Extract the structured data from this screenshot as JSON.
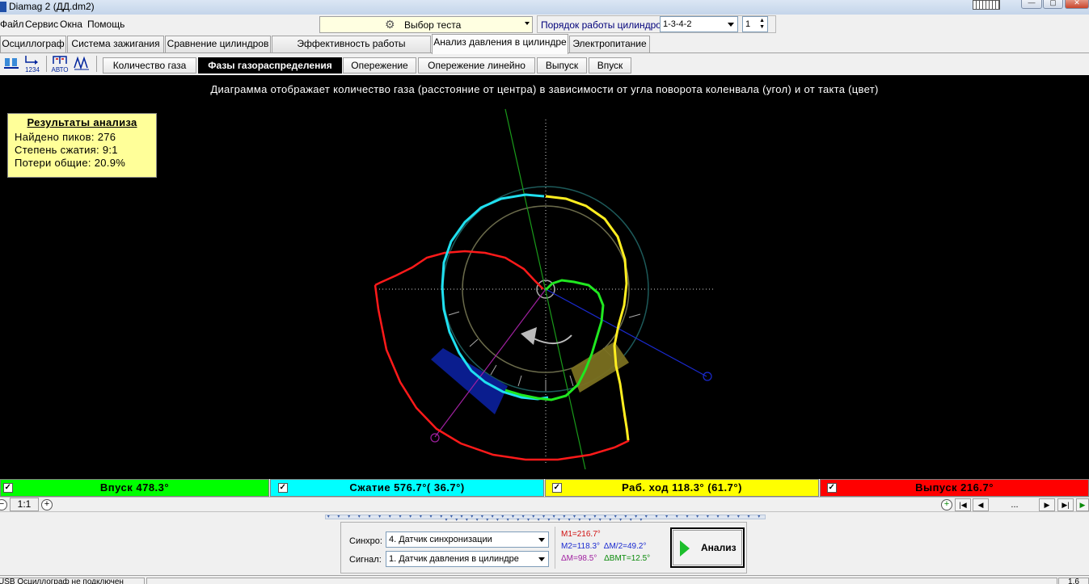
{
  "window": {
    "title": "Diamag 2 (ДД.dm2)",
    "controls": [
      "—",
      "▢",
      "✕"
    ]
  },
  "menu": {
    "items": [
      "Файл",
      "Сервис",
      "Окна",
      "Помощь"
    ]
  },
  "test_selector": {
    "label": "Выбор теста"
  },
  "cylinder_order": {
    "label": "Порядок работы цилиндров",
    "value": "1-3-4-2",
    "cylinder": "1"
  },
  "main_tabs": [
    "Осциллограф",
    "Система зажигания",
    "Сравнение цилиндров",
    "Эффективность работы цилиндров",
    "Анализ давления в цилиндре",
    "Электропитание"
  ],
  "toolbar": {
    "auto_label": "АВТО",
    "seq_label": "1234"
  },
  "sub_tabs": [
    "Количество газа",
    "Фазы газораспределения",
    "Опережение",
    "Опережение линейно",
    "Выпуск",
    "Впуск"
  ],
  "diagram": {
    "caption": "Диаграмма отображает количество газа (расстояние от центра) в зависимости от угла поворота коленвала (угол) и от такта (цвет)"
  },
  "results": {
    "title": "Результаты анализа",
    "lines": [
      "Найдено пиков: 276",
      "Степень сжатия: 9:1",
      "Потери общие: 20.9%"
    ]
  },
  "phases": [
    {
      "label": "Впуск 478.3°",
      "color": "#00ff00"
    },
    {
      "label": "Сжатие 576.7°( 36.7°)",
      "color": "#00ffff"
    },
    {
      "label": "Раб. ход 118.3° (61.7°)",
      "color": "#ffff00"
    },
    {
      "label": "Выпуск 216.7°",
      "color": "#ff0000"
    }
  ],
  "zoom": {
    "ratio": "1:1",
    "page": "..."
  },
  "controls": {
    "sync_label": "Синхро:",
    "sync_value": "4.  Датчик синхронизации",
    "signal_label": "Сигнал:",
    "signal_value": "1.  Датчик давления в цилиндре",
    "m1": "M1=216.7°",
    "m2": "M2=118.3°",
    "dm_half": "ΔM/2=49.2°",
    "dm": "ΔM=98.5°",
    "dvmt": "ΔВМТ=12.5°",
    "run_label": "Анализ"
  },
  "status": {
    "left": "USB Осциллограф не подключен",
    "right": "1.6"
  }
}
